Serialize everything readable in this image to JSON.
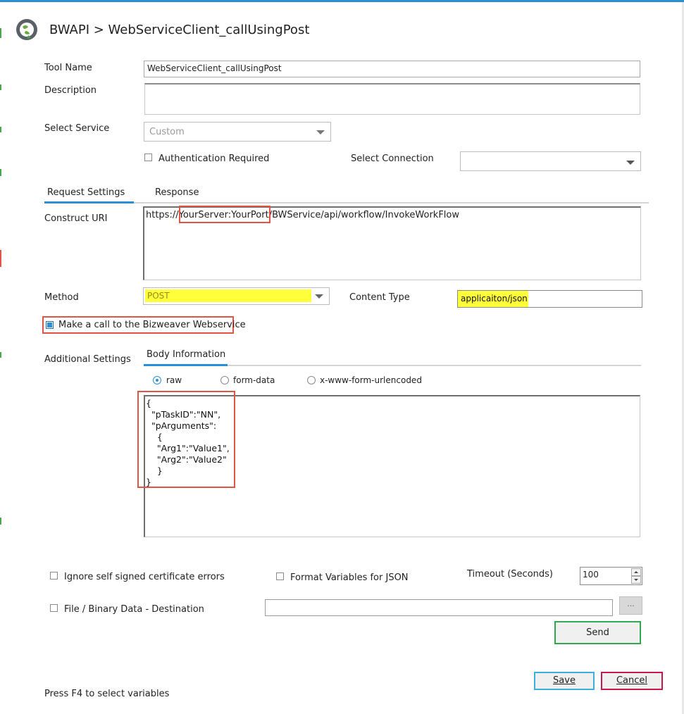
{
  "header": {
    "title": "BWAPI > WebServiceClient_callUsingPost",
    "icon": "globe-app-icon"
  },
  "form": {
    "tool_name_label": "Tool Name",
    "tool_name_value": "WebServiceClient_callUsingPost",
    "description_label": "Description",
    "description_value": "",
    "select_service_label": "Select Service",
    "select_service_value": "Custom",
    "auth_required_label": "Authentication Required",
    "auth_required_checked": false,
    "select_connection_label": "Select Connection",
    "select_connection_value": ""
  },
  "tabs": {
    "request_settings": "Request Settings",
    "response": "Response",
    "active": "Request Settings"
  },
  "uri": {
    "label": "Construct URI",
    "prefix": "https://",
    "server": "YourServer",
    "sep": ":",
    "port": "YourPort",
    "path": "/BWService/api/workflow/InvokeWorkFlow"
  },
  "method": {
    "label": "Method",
    "value": "POST"
  },
  "content_type": {
    "label": "Content Type",
    "value": "applicaiton/json"
  },
  "bizweaver_call": {
    "label": "Make a call to the Bizweaver Webservice",
    "checked": true
  },
  "additional": {
    "label": "Additional Settings",
    "tab": "Body Information",
    "radio_raw": "raw",
    "radio_form_data": "form-data",
    "radio_urlencoded": "x-www-form-urlencoded",
    "selected": "raw",
    "body_text": "{\n  \"pTaskID\":\"NN\",\n  \"pArguments\":\n    {\n    \"Arg1\":\"Value1\",\n    \"Arg2\":\"Value2\"\n    }\n}"
  },
  "options": {
    "ignore_cert_label": "Ignore self signed certificate errors",
    "format_json_label": "Format Variables for JSON",
    "timeout_label": "Timeout (Seconds)",
    "timeout_value": "100",
    "file_dest_label": "File / Binary Data - Destination",
    "file_dest_value": "",
    "browse_label": "..."
  },
  "buttons": {
    "send": "Send",
    "save": "Save",
    "cancel": "Cancel"
  },
  "footer": {
    "hint": "Press F4 to select variables"
  },
  "colors": {
    "accent_blue": "#2b8fd6",
    "highlight_yellow": "#ffff3a",
    "annotation_red": "#e05545",
    "send_border": "#2fa84f",
    "save_border": "#3ab0e0",
    "cancel_border": "#c8184a"
  }
}
